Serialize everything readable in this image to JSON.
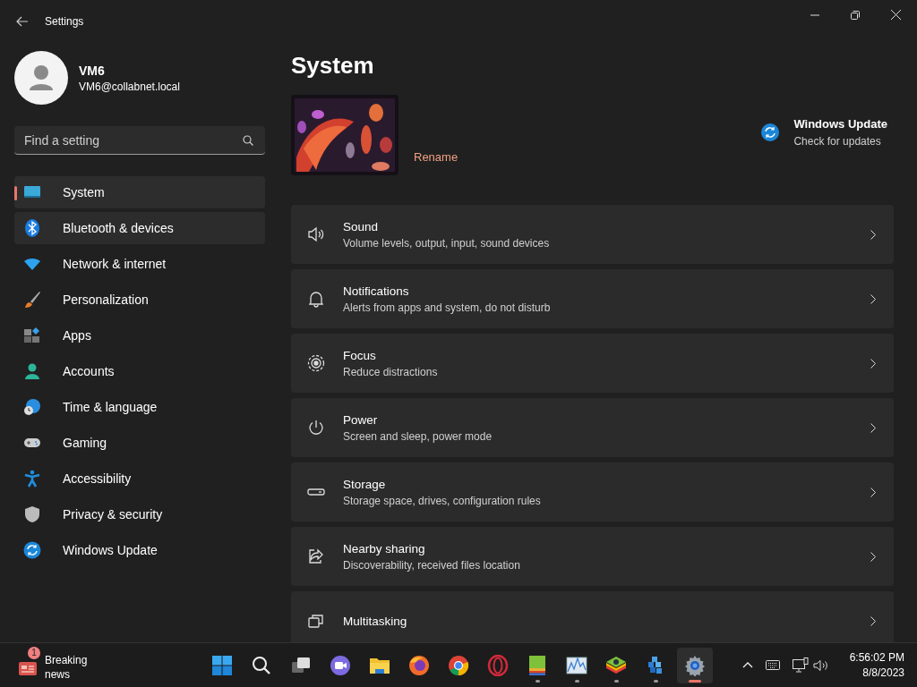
{
  "window": {
    "title": "Settings"
  },
  "account": {
    "name": "VM6",
    "email": "VM6@collabnet.local"
  },
  "search": {
    "placeholder": "Find a setting"
  },
  "nav": [
    {
      "kind": "system",
      "label": "System",
      "selected": true,
      "hovered": false
    },
    {
      "kind": "bluetooth",
      "label": "Bluetooth & devices",
      "selected": false,
      "hovered": true
    },
    {
      "kind": "network",
      "label": "Network & internet",
      "selected": false,
      "hovered": false
    },
    {
      "kind": "brush",
      "label": "Personalization",
      "selected": false,
      "hovered": false
    },
    {
      "kind": "apps",
      "label": "Apps",
      "selected": false,
      "hovered": false
    },
    {
      "kind": "accounts",
      "label": "Accounts",
      "selected": false,
      "hovered": false
    },
    {
      "kind": "time",
      "label": "Time & language",
      "selected": false,
      "hovered": false
    },
    {
      "kind": "gaming",
      "label": "Gaming",
      "selected": false,
      "hovered": false
    },
    {
      "kind": "accessibility",
      "label": "Accessibility",
      "selected": false,
      "hovered": false
    },
    {
      "kind": "privacy",
      "label": "Privacy & security",
      "selected": false,
      "hovered": false
    },
    {
      "kind": "update",
      "label": "Windows Update",
      "selected": false,
      "hovered": false
    }
  ],
  "page": {
    "title": "System",
    "device": {
      "kind": "picture",
      "rename": "Rename"
    },
    "update": {
      "title": "Windows Update",
      "subtitle": "Check for updates"
    },
    "cards": [
      {
        "kind": "sound",
        "title": "Sound",
        "description": "Volume levels, output, input, sound devices"
      },
      {
        "kind": "notifications",
        "title": "Notifications",
        "description": "Alerts from apps and system, do not disturb"
      },
      {
        "kind": "focus",
        "title": "Focus",
        "description": "Reduce distractions"
      },
      {
        "kind": "power",
        "title": "Power",
        "description": "Screen and sleep, power mode"
      },
      {
        "kind": "storage",
        "title": "Storage",
        "description": "Storage space, drives, configuration rules"
      },
      {
        "kind": "share",
        "title": "Nearby sharing",
        "description": "Discoverability, received files location"
      },
      {
        "kind": "multitasking",
        "title": "Multitasking"
      }
    ]
  },
  "taskbar": {
    "news": {
      "badge": "1",
      "title": "Breaking news"
    },
    "apps": [
      {
        "kind": "start",
        "running": false,
        "selected": false
      },
      {
        "kind": "search",
        "running": false,
        "selected": false
      },
      {
        "kind": "task-view",
        "running": false,
        "selected": false
      },
      {
        "kind": "chat",
        "running": false,
        "selected": false
      },
      {
        "kind": "folder",
        "running": false,
        "selected": false
      },
      {
        "kind": "firefox",
        "running": false,
        "selected": false
      },
      {
        "kind": "chrome",
        "running": false,
        "selected": false
      },
      {
        "kind": "opera",
        "running": false,
        "selected": false
      },
      {
        "kind": "stack",
        "running": true,
        "selected": false
      },
      {
        "kind": "chart",
        "running": true,
        "selected": false
      },
      {
        "kind": "layers",
        "running": true,
        "selected": false
      },
      {
        "kind": "cubes",
        "running": true,
        "selected": false
      },
      {
        "kind": "settings",
        "running": true,
        "selected": true
      }
    ],
    "clock": {
      "time": "6:56:02 PM",
      "date": "8/8/2023"
    }
  }
}
